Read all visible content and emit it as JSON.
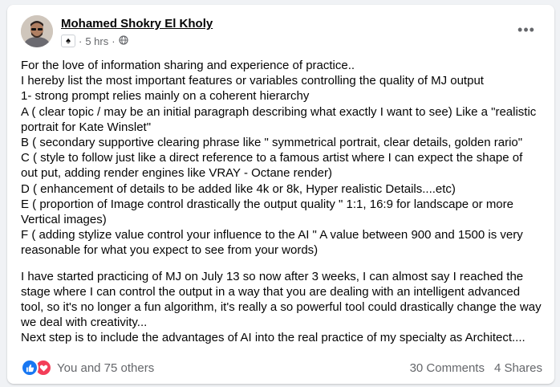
{
  "post": {
    "author": "Mohamed Shokry El Kholy",
    "time": "5 hrs",
    "separator": "·",
    "audience_icon": "globe-icon",
    "badge_icon": "spade-icon",
    "paragraphs": [
      "For the love of information sharing and experience of practice..\nI hereby list the most important features or variables controlling the quality of MJ output\n1- strong prompt relies mainly on a coherent hierarchy\nA ( clear topic / may be an initial paragraph describing what exactly I want to see) Like a \"realistic portrait for Kate Winslet\"\nB ( secondary supportive clearing phrase like \" symmetrical portrait, clear details, golden rario\"\nC ( style to follow just like a direct reference to a famous artist where I can expect the shape of out put, adding render engines like VRAY - Octane render)\nD ( enhancement of details to be added like 4k or 8k, Hyper realistic Details....etc)\nE ( proportion of Image control drastically the output quality \" 1:1, 16:9 for landscape or more Vertical images)\nF ( adding stylize value control your influence to the AI \" A value between 900 and 1500 is very reasonable for what you expect to see from your words)",
      "I have started practicing of MJ on July 13  so now after 3 weeks, I can almost say I reached the stage where I can control the output in a way that you are dealing with an intelligent advanced tool, so it's no longer a fun algorithm, it's really a so powerful tool could drastically change the way we deal with creativity...\nNext step is to include the advantages of AI into the real practice of my specialty as Architect...."
    ]
  },
  "footer": {
    "reactions_text": "You and 75 others",
    "comments": "30 Comments",
    "shares": "4 Shares"
  },
  "colors": {
    "like_blue": "#1877f2",
    "love_red": "#f33e58",
    "secondary_text": "#65676b"
  }
}
